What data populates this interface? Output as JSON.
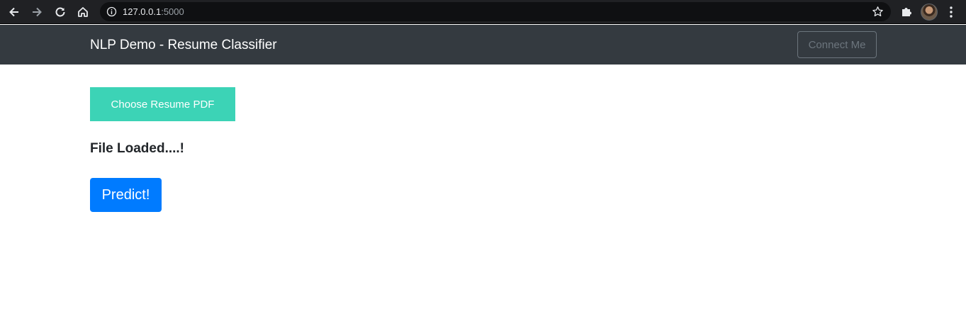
{
  "browser": {
    "url_host": "127.0.0.1",
    "url_port": ":5000",
    "icons": [
      "back-arrow-icon",
      "forward-arrow-icon",
      "reload-icon",
      "home-icon",
      "info-icon",
      "star-icon",
      "extensions-icon",
      "avatar",
      "kebab-menu-icon"
    ]
  },
  "navbar": {
    "brand": "NLP Demo - Resume Classifier",
    "connect_label": "Connect Me"
  },
  "main": {
    "upload_label": "Choose Resume PDF",
    "status": "File Loaded....!",
    "predict_label": "Predict!"
  },
  "colors": {
    "chrome_bg": "#202124",
    "navbar_bg": "#343a40",
    "upload_bg": "#3cd3b6",
    "predict_bg": "#007bff",
    "outline_gray": "#6c757d"
  }
}
